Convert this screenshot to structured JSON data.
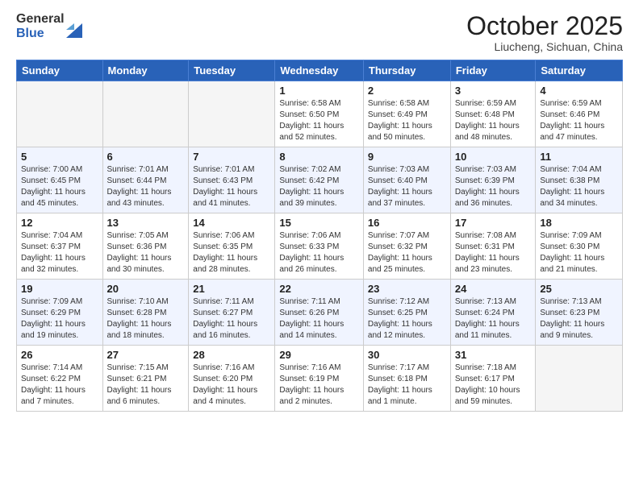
{
  "logo": {
    "general": "General",
    "blue": "Blue"
  },
  "header": {
    "month": "October 2025",
    "location": "Liucheng, Sichuan, China"
  },
  "weekdays": [
    "Sunday",
    "Monday",
    "Tuesday",
    "Wednesday",
    "Thursday",
    "Friday",
    "Saturday"
  ],
  "weeks": [
    [
      {
        "day": "",
        "info": ""
      },
      {
        "day": "",
        "info": ""
      },
      {
        "day": "",
        "info": ""
      },
      {
        "day": "1",
        "info": "Sunrise: 6:58 AM\nSunset: 6:50 PM\nDaylight: 11 hours\nand 52 minutes."
      },
      {
        "day": "2",
        "info": "Sunrise: 6:58 AM\nSunset: 6:49 PM\nDaylight: 11 hours\nand 50 minutes."
      },
      {
        "day": "3",
        "info": "Sunrise: 6:59 AM\nSunset: 6:48 PM\nDaylight: 11 hours\nand 48 minutes."
      },
      {
        "day": "4",
        "info": "Sunrise: 6:59 AM\nSunset: 6:46 PM\nDaylight: 11 hours\nand 47 minutes."
      }
    ],
    [
      {
        "day": "5",
        "info": "Sunrise: 7:00 AM\nSunset: 6:45 PM\nDaylight: 11 hours\nand 45 minutes."
      },
      {
        "day": "6",
        "info": "Sunrise: 7:01 AM\nSunset: 6:44 PM\nDaylight: 11 hours\nand 43 minutes."
      },
      {
        "day": "7",
        "info": "Sunrise: 7:01 AM\nSunset: 6:43 PM\nDaylight: 11 hours\nand 41 minutes."
      },
      {
        "day": "8",
        "info": "Sunrise: 7:02 AM\nSunset: 6:42 PM\nDaylight: 11 hours\nand 39 minutes."
      },
      {
        "day": "9",
        "info": "Sunrise: 7:03 AM\nSunset: 6:40 PM\nDaylight: 11 hours\nand 37 minutes."
      },
      {
        "day": "10",
        "info": "Sunrise: 7:03 AM\nSunset: 6:39 PM\nDaylight: 11 hours\nand 36 minutes."
      },
      {
        "day": "11",
        "info": "Sunrise: 7:04 AM\nSunset: 6:38 PM\nDaylight: 11 hours\nand 34 minutes."
      }
    ],
    [
      {
        "day": "12",
        "info": "Sunrise: 7:04 AM\nSunset: 6:37 PM\nDaylight: 11 hours\nand 32 minutes."
      },
      {
        "day": "13",
        "info": "Sunrise: 7:05 AM\nSunset: 6:36 PM\nDaylight: 11 hours\nand 30 minutes."
      },
      {
        "day": "14",
        "info": "Sunrise: 7:06 AM\nSunset: 6:35 PM\nDaylight: 11 hours\nand 28 minutes."
      },
      {
        "day": "15",
        "info": "Sunrise: 7:06 AM\nSunset: 6:33 PM\nDaylight: 11 hours\nand 26 minutes."
      },
      {
        "day": "16",
        "info": "Sunrise: 7:07 AM\nSunset: 6:32 PM\nDaylight: 11 hours\nand 25 minutes."
      },
      {
        "day": "17",
        "info": "Sunrise: 7:08 AM\nSunset: 6:31 PM\nDaylight: 11 hours\nand 23 minutes."
      },
      {
        "day": "18",
        "info": "Sunrise: 7:09 AM\nSunset: 6:30 PM\nDaylight: 11 hours\nand 21 minutes."
      }
    ],
    [
      {
        "day": "19",
        "info": "Sunrise: 7:09 AM\nSunset: 6:29 PM\nDaylight: 11 hours\nand 19 minutes."
      },
      {
        "day": "20",
        "info": "Sunrise: 7:10 AM\nSunset: 6:28 PM\nDaylight: 11 hours\nand 18 minutes."
      },
      {
        "day": "21",
        "info": "Sunrise: 7:11 AM\nSunset: 6:27 PM\nDaylight: 11 hours\nand 16 minutes."
      },
      {
        "day": "22",
        "info": "Sunrise: 7:11 AM\nSunset: 6:26 PM\nDaylight: 11 hours\nand 14 minutes."
      },
      {
        "day": "23",
        "info": "Sunrise: 7:12 AM\nSunset: 6:25 PM\nDaylight: 11 hours\nand 12 minutes."
      },
      {
        "day": "24",
        "info": "Sunrise: 7:13 AM\nSunset: 6:24 PM\nDaylight: 11 hours\nand 11 minutes."
      },
      {
        "day": "25",
        "info": "Sunrise: 7:13 AM\nSunset: 6:23 PM\nDaylight: 11 hours\nand 9 minutes."
      }
    ],
    [
      {
        "day": "26",
        "info": "Sunrise: 7:14 AM\nSunset: 6:22 PM\nDaylight: 11 hours\nand 7 minutes."
      },
      {
        "day": "27",
        "info": "Sunrise: 7:15 AM\nSunset: 6:21 PM\nDaylight: 11 hours\nand 6 minutes."
      },
      {
        "day": "28",
        "info": "Sunrise: 7:16 AM\nSunset: 6:20 PM\nDaylight: 11 hours\nand 4 minutes."
      },
      {
        "day": "29",
        "info": "Sunrise: 7:16 AM\nSunset: 6:19 PM\nDaylight: 11 hours\nand 2 minutes."
      },
      {
        "day": "30",
        "info": "Sunrise: 7:17 AM\nSunset: 6:18 PM\nDaylight: 11 hours\nand 1 minute."
      },
      {
        "day": "31",
        "info": "Sunrise: 7:18 AM\nSunset: 6:17 PM\nDaylight: 10 hours\nand 59 minutes."
      },
      {
        "day": "",
        "info": ""
      }
    ]
  ]
}
